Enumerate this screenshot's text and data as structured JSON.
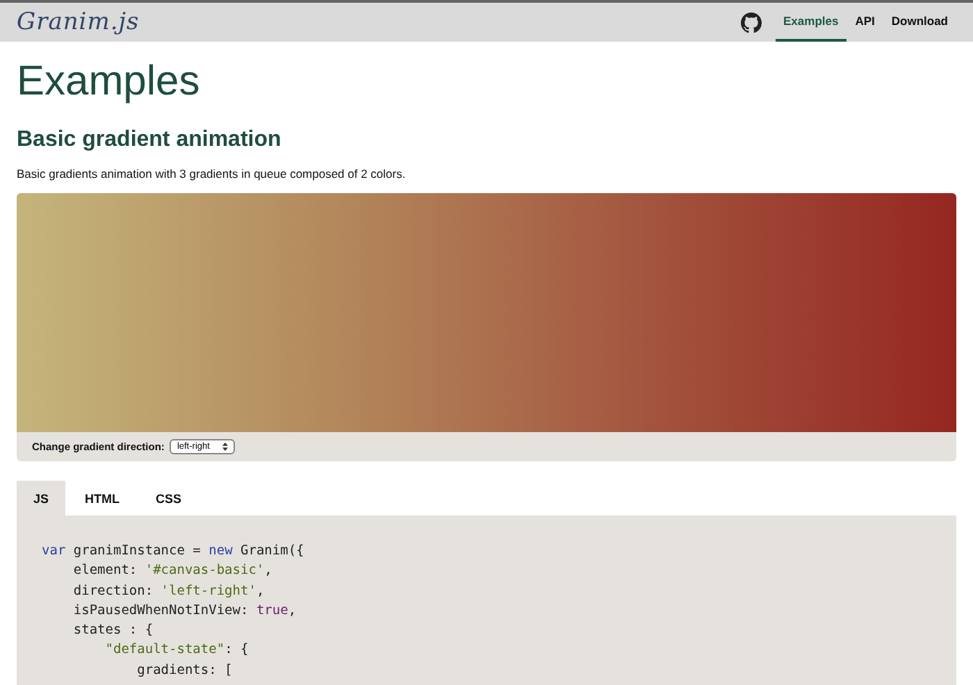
{
  "header": {
    "logo": "Granim.js",
    "nav": [
      {
        "label": "Examples",
        "selected": true
      },
      {
        "label": "API",
        "selected": false
      },
      {
        "label": "Download",
        "selected": false
      }
    ]
  },
  "page_title": "Examples",
  "section": {
    "title": "Basic gradient animation",
    "description": "Basic gradients animation with 3 gradients in queue composed of 2 colors.",
    "control": {
      "label": "Change gradient direction:",
      "value": "left-right"
    },
    "tabs": [
      {
        "label": "JS",
        "selected": true
      },
      {
        "label": "HTML",
        "selected": false
      },
      {
        "label": "CSS",
        "selected": false
      }
    ],
    "code_lines": [
      [
        {
          "text": "var",
          "kind": "keyword"
        },
        {
          "text": " granimInstance = ",
          "kind": "plain"
        },
        {
          "text": "new",
          "kind": "keyword"
        },
        {
          "text": " Granim({",
          "kind": "plain"
        }
      ],
      [
        {
          "text": "    element: ",
          "kind": "plain"
        },
        {
          "text": "'#canvas-basic'",
          "kind": "string"
        },
        {
          "text": ",",
          "kind": "plain"
        }
      ],
      [
        {
          "text": "    direction: ",
          "kind": "plain"
        },
        {
          "text": "'left-right'",
          "kind": "string"
        },
        {
          "text": ",",
          "kind": "plain"
        }
      ],
      [
        {
          "text": "    isPausedWhenNotInView: ",
          "kind": "plain"
        },
        {
          "text": "true",
          "kind": "literal"
        },
        {
          "text": ",",
          "kind": "plain"
        }
      ],
      [
        {
          "text": "    states : {",
          "kind": "plain"
        }
      ],
      [
        {
          "text": "        \"default-state\"",
          "kind": "string"
        },
        {
          "text": ": {",
          "kind": "plain"
        }
      ],
      [
        {
          "text": "            gradients: [",
          "kind": "plain"
        }
      ]
    ]
  }
}
